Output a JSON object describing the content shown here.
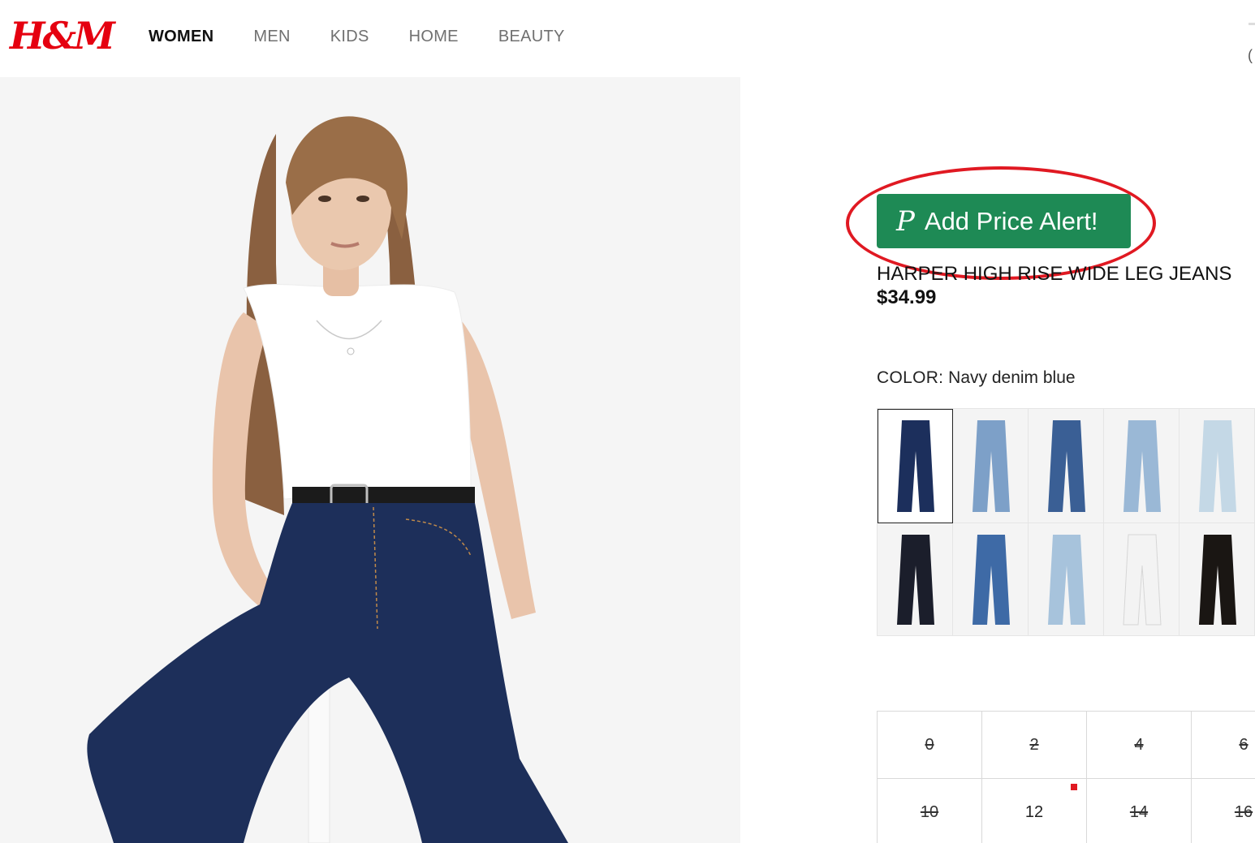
{
  "brand": {
    "logo_text": "H&M",
    "color": "#e50010"
  },
  "nav": {
    "items": [
      {
        "label": "WOMEN",
        "active": true
      },
      {
        "label": "MEN",
        "active": false
      },
      {
        "label": "KIDS",
        "active": false
      },
      {
        "label": "HOME",
        "active": false
      },
      {
        "label": "BEAUTY",
        "active": false
      }
    ]
  },
  "extension": {
    "button_label": "Add Price Alert!",
    "icon": "P",
    "color": "#1e8a55",
    "highlight_color": "#e01922"
  },
  "product": {
    "name": "HARPER HIGH RISE WIDE LEG JEANS",
    "price": "$34.99",
    "color_key": "COLOR:",
    "color_value": "Navy denim blue"
  },
  "swatches": [
    {
      "color_name": "navy",
      "hex": "#1c2f5c",
      "selected": true
    },
    {
      "color_name": "light-blue",
      "hex": "#7da0c8",
      "selected": false
    },
    {
      "color_name": "mid-blue",
      "hex": "#3a5f95",
      "selected": false
    },
    {
      "color_name": "pale-blue",
      "hex": "#9ab8d6",
      "selected": false
    },
    {
      "color_name": "very-light-blue",
      "hex": "#c4d8e6",
      "selected": false
    },
    {
      "color_name": "black-denim",
      "hex": "#1b1e2b",
      "selected": false
    },
    {
      "color_name": "denim-blue",
      "hex": "#3e6aa6",
      "selected": false
    },
    {
      "color_name": "sky-blue",
      "hex": "#a7c3dc",
      "selected": false
    },
    {
      "color_name": "white",
      "hex": "#f3f3f3",
      "selected": false
    },
    {
      "color_name": "black",
      "hex": "#1a1613",
      "selected": false
    }
  ],
  "sizes": [
    {
      "label": "0",
      "available": false,
      "low_stock": false
    },
    {
      "label": "2",
      "available": false,
      "low_stock": false
    },
    {
      "label": "4",
      "available": false,
      "low_stock": false
    },
    {
      "label": "6",
      "available": false,
      "low_stock": false
    },
    {
      "label": "10",
      "available": false,
      "low_stock": false
    },
    {
      "label": "12",
      "available": true,
      "low_stock": true
    },
    {
      "label": "14",
      "available": false,
      "low_stock": false
    },
    {
      "label": "16",
      "available": false,
      "low_stock": false
    }
  ]
}
